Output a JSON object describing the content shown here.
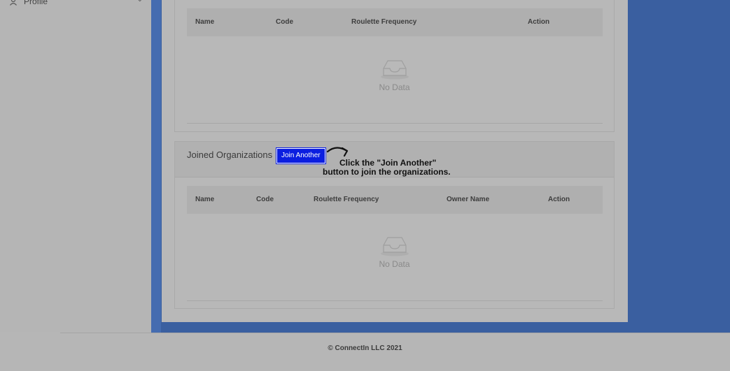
{
  "sidebar": {
    "items": [
      {
        "label": "Profile",
        "icon": "user-icon"
      }
    ]
  },
  "org_table": {
    "columns": [
      "Name",
      "Code",
      "Roulette Frequency",
      "Action"
    ],
    "empty_text": "No Data"
  },
  "joined": {
    "title": "Joined Organizations",
    "join_button": "Join Another",
    "columns": [
      "Name",
      "Code",
      "Roulette Frequency",
      "Owner Name",
      "Action"
    ],
    "empty_text": "No Data"
  },
  "hint": {
    "line1": "Click the \"Join Another\"",
    "line2": "button to join the organizations."
  },
  "footer": {
    "copyright": "© ConnectIn LLC 2021"
  },
  "colors": {
    "overlay": "#b7b7b7",
    "blue_background": "#3a5fa0",
    "join_button": "#0b1ee0"
  }
}
